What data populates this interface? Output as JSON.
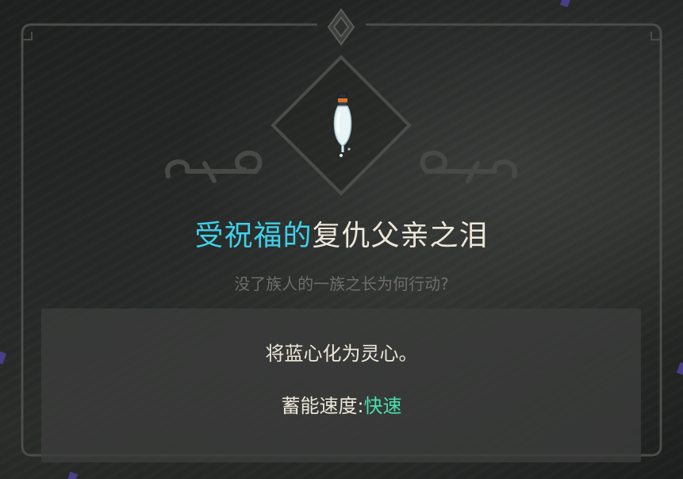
{
  "item": {
    "title_prefix": "受祝福的",
    "title_name": "复仇父亲之泪",
    "flavor_text": "没了族人的一族之长为何行动?",
    "effect_text": "将蓝心化为灵心。",
    "charge_label": "蓄能速度:",
    "charge_value": "快速",
    "icon": "tear-potion-icon"
  },
  "colors": {
    "blessed_accent": "#3fd0ea",
    "speed_accent": "#47e0b0",
    "title_text": "#ece7d8",
    "flavor_text": "#6f6c68",
    "frame_line": "#4a4c4a",
    "gem": "#4a3d8a"
  }
}
